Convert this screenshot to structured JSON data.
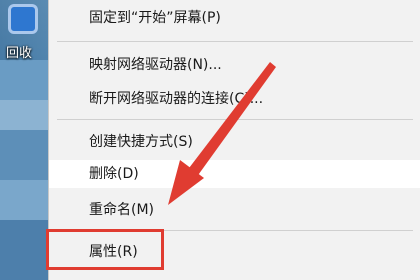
{
  "desktop": {
    "icon_label": "回收",
    "icon_name": "recycle-bin-icon"
  },
  "context_menu": {
    "items": [
      {
        "label": "固定到“开始”屏幕(P)"
      },
      {
        "label": "映射网络驱动器(N)..."
      },
      {
        "label": "断开网络驱动器的连接(C)..."
      },
      {
        "label": "创建快捷方式(S)"
      },
      {
        "label": "删除(D)"
      },
      {
        "label": "重命名(M)"
      },
      {
        "label": "属性(R)"
      }
    ]
  },
  "annotation": {
    "highlight_color": "#e03c31",
    "arrow_color": "#e03c31",
    "target_item": "属性(R)"
  }
}
